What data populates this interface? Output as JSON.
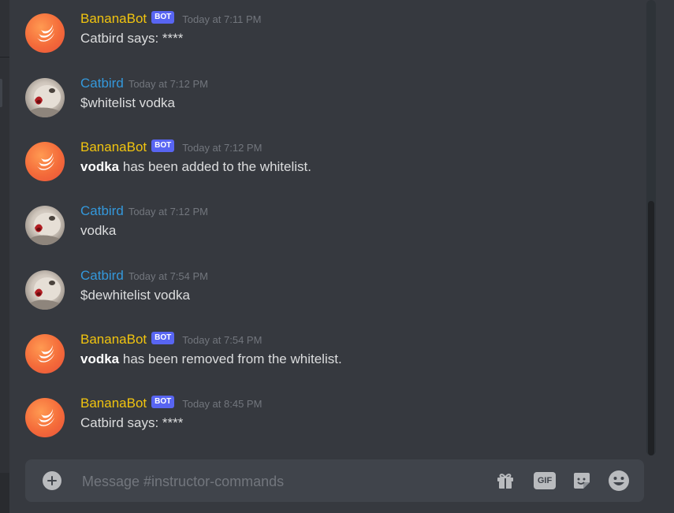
{
  "messages": [
    {
      "author": "BananaBot",
      "is_bot": true,
      "badge": "BOT",
      "timestamp": "Today at 7:11 PM",
      "text": "Catbird says: ****"
    },
    {
      "author": "Catbird",
      "is_bot": false,
      "timestamp": "Today at 7:12 PM",
      "text": "$whitelist vodka"
    },
    {
      "author": "BananaBot",
      "is_bot": true,
      "badge": "BOT",
      "timestamp": "Today at 7:12 PM",
      "bold": "vodka",
      "text": " has been added to the whitelist."
    },
    {
      "author": "Catbird",
      "is_bot": false,
      "timestamp": "Today at 7:12 PM",
      "text": "vodka"
    },
    {
      "author": "Catbird",
      "is_bot": false,
      "timestamp": "Today at 7:54 PM",
      "text": "$dewhitelist vodka"
    },
    {
      "author": "BananaBot",
      "is_bot": true,
      "badge": "BOT",
      "timestamp": "Today at 7:54 PM",
      "bold": "vodka",
      "text": " has been removed from the whitelist."
    },
    {
      "author": "BananaBot",
      "is_bot": true,
      "badge": "BOT",
      "timestamp": "Today at 8:45 PM",
      "text": "Catbird says: ****"
    }
  ],
  "composer": {
    "placeholder": "Message #instructor-commands",
    "gif_label": "GIF"
  },
  "colors": {
    "background": "#36393f",
    "bot_name": "#f1c40f",
    "user_name": "#3498db",
    "bot_badge": "#5865f2",
    "timestamp": "#72767d",
    "text": "#dcddde"
  },
  "icons": [
    "plus-circle-icon",
    "gift-icon",
    "gif-icon",
    "sticker-icon",
    "emoji-icon"
  ]
}
